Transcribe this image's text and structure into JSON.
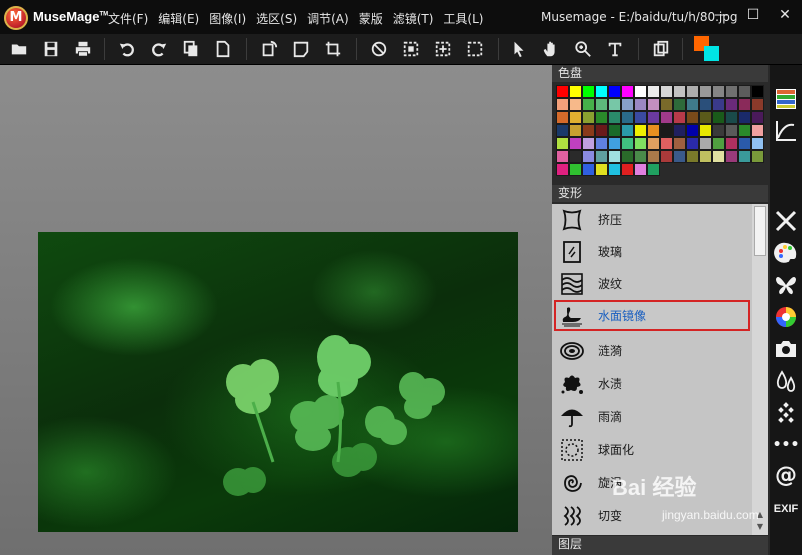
{
  "app": {
    "name": "MuseMage",
    "window_title": "Musemage - E:/baidu/tu/h/80.jpg"
  },
  "menu": [
    {
      "label": "文件(F)",
      "enabled": true
    },
    {
      "label": "编辑(E)",
      "enabled": true
    },
    {
      "label": "图像(I)",
      "enabled": true
    },
    {
      "label": "选区(S)",
      "enabled": true
    },
    {
      "label": "调节(A)",
      "enabled": true
    },
    {
      "label": "蒙版",
      "enabled": true
    },
    {
      "label": "滤镜(T)",
      "enabled": true
    },
    {
      "label": "工具(L)",
      "enabled": true
    }
  ],
  "window_buttons": [
    "minimize-icon",
    "maximize-icon",
    "close-icon"
  ],
  "toolbar_icons": [
    "open-folder-icon",
    "save-icon",
    "print-icon",
    "undo-icon",
    "redo-icon",
    "copy-icon",
    "paste-icon",
    "rotate-icon",
    "flip-icon",
    "crop-icon",
    "no-icon",
    "select-rect-icon",
    "select-move-icon",
    "select-dashed-icon",
    "pointer-icon",
    "hand-icon",
    "zoom-icon",
    "text-icon",
    "layers-icon",
    "color-swap-icon"
  ],
  "colors": {
    "foreground": "#ff6600",
    "background": "#00e5e5",
    "highlight": "#d42424",
    "selected_text": "#1a5fc0"
  },
  "palette": {
    "title": "色盘",
    "swatches": [
      "#ff0000",
      "#ffff00",
      "#00ff00",
      "#00ffff",
      "#0000ff",
      "#ff00ff",
      "#ffffff",
      "#ebebeb",
      "#d6d6d6",
      "#c2c2c2",
      "#adadad",
      "#999999",
      "#858585",
      "#707070",
      "#5c5c5c",
      "#000000",
      "#f4a07a",
      "#f7b98a",
      "#46b04a",
      "#5db97b",
      "#77c7a7",
      "#88a0c8",
      "#9b87c2",
      "#c28fc0",
      "#7a6a2a",
      "#2e6a3a",
      "#3f7a8a",
      "#2a4f7a",
      "#3a3a8a",
      "#6a2a7a",
      "#8a2a5a",
      "#8a3a2a",
      "#d46a2a",
      "#e0b030",
      "#8aa030",
      "#2a8a2a",
      "#2a8a6a",
      "#2a6a8a",
      "#3a4aa0",
      "#6a3aa0",
      "#a03a8a",
      "#b83a4a",
      "#7a4a1a",
      "#5a5a1a",
      "#1a5a1a",
      "#1a4a4a",
      "#1a2a6a",
      "#4a1a5a",
      "#1a3a6a",
      "#c8a030",
      "#8a3a1a",
      "#6a1a1a",
      "#1a6a2a",
      "#2a9aaa",
      "#f0f000",
      "#e89020",
      "#1a1a1a",
      "#202060",
      "#0000aa",
      "#e8e800",
      "#3a3a3a",
      "#5a5a5a",
      "#2a8a2a",
      "#f0a0a0",
      "#b0e040",
      "#c040c0",
      "#c0a0e0",
      "#6080e0",
      "#40a0e0",
      "#40c080",
      "#80e060",
      "#e0a060",
      "#e06060",
      "#a06040",
      "#2a2aaa",
      "#aaaaaa",
      "#50a040",
      "#b03060",
      "#2a5aaa",
      "#90c0f0",
      "#e060a0",
      "#2a2a2a",
      "#8a8ae0",
      "#60a0a0",
      "#a0e0e0",
      "#2a6a2a",
      "#4a8a4a",
      "#aa7a4a",
      "#aa3a3a",
      "#3a5a8a",
      "#7a7a2a",
      "#c0c060",
      "#e0e0a0",
      "#9a3a7a",
      "#3a9a9a",
      "#7a9a3a",
      "#e02080",
      "#30c030",
      "#3060e0",
      "#e0e020",
      "#20c0e0",
      "#e02020",
      "#e080e0",
      "#20a060"
    ]
  },
  "transform": {
    "title": "变形",
    "items": [
      {
        "label": "挤压",
        "icon": "pinch-icon"
      },
      {
        "label": "玻璃",
        "icon": "glass-icon"
      },
      {
        "label": "波纹",
        "icon": "wave-icon"
      },
      {
        "label": "水面镜像",
        "icon": "swan-reflection-icon"
      },
      {
        "label": "涟漪",
        "icon": "ripple-icon"
      },
      {
        "label": "水渍",
        "icon": "splash-icon"
      },
      {
        "label": "雨滴",
        "icon": "umbrella-icon"
      },
      {
        "label": "球面化",
        "icon": "spherize-icon"
      },
      {
        "label": "旋涡",
        "icon": "swirl-icon"
      },
      {
        "label": "切变",
        "icon": "shear-icon"
      }
    ],
    "selected": "水面镜像"
  },
  "layers": {
    "title": "图层"
  },
  "rail_icons": [
    "swatches-icon",
    "curve-icon",
    "tools-icon",
    "palette-icon",
    "butterfly-icon",
    "color-wheel-icon",
    "camera-icon",
    "drops-icon",
    "pattern-icon",
    "more-icon",
    "at-icon",
    "exif-icon"
  ],
  "rail_text": {
    "exif": "EXIF",
    "at": "@",
    "more": "•••"
  },
  "watermark": {
    "brand": "Bai 经验",
    "url": "jingyan.baidu.com"
  }
}
